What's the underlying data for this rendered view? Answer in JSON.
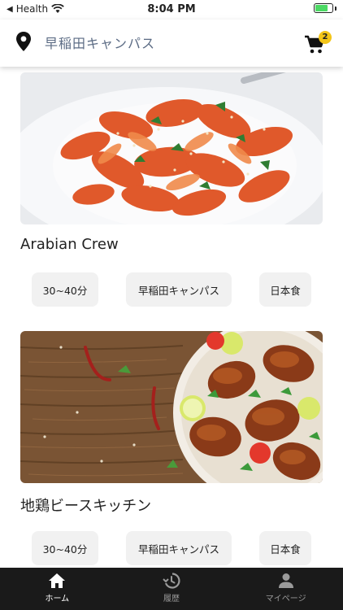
{
  "status_bar": {
    "back_app": "Health",
    "time": "8:04 PM",
    "battery_level": 0.75
  },
  "header": {
    "location": "早稲田キャンパス",
    "cart_count": "2"
  },
  "restaurants": [
    {
      "name": "Arabian Crew",
      "image": "pasta",
      "tags": [
        "30~40分",
        "早稲田キャンパス",
        "日本食"
      ]
    },
    {
      "name": "地鶏ビースキッチン",
      "image": "grilled-chicken",
      "tags": [
        "30~40分",
        "早稲田キャンパス",
        "日本食"
      ]
    }
  ],
  "tabbar": {
    "items": [
      {
        "label": "ホーム",
        "icon": "home-icon",
        "active": true
      },
      {
        "label": "履歴",
        "icon": "history-icon",
        "active": false
      },
      {
        "label": "マイページ",
        "icon": "person-icon",
        "active": false
      }
    ]
  },
  "colors": {
    "accent_badge": "#f3c518",
    "tabbar_bg": "#1a1a1a",
    "tag_bg": "#f1f1f1",
    "location_text": "#5b6b84"
  }
}
